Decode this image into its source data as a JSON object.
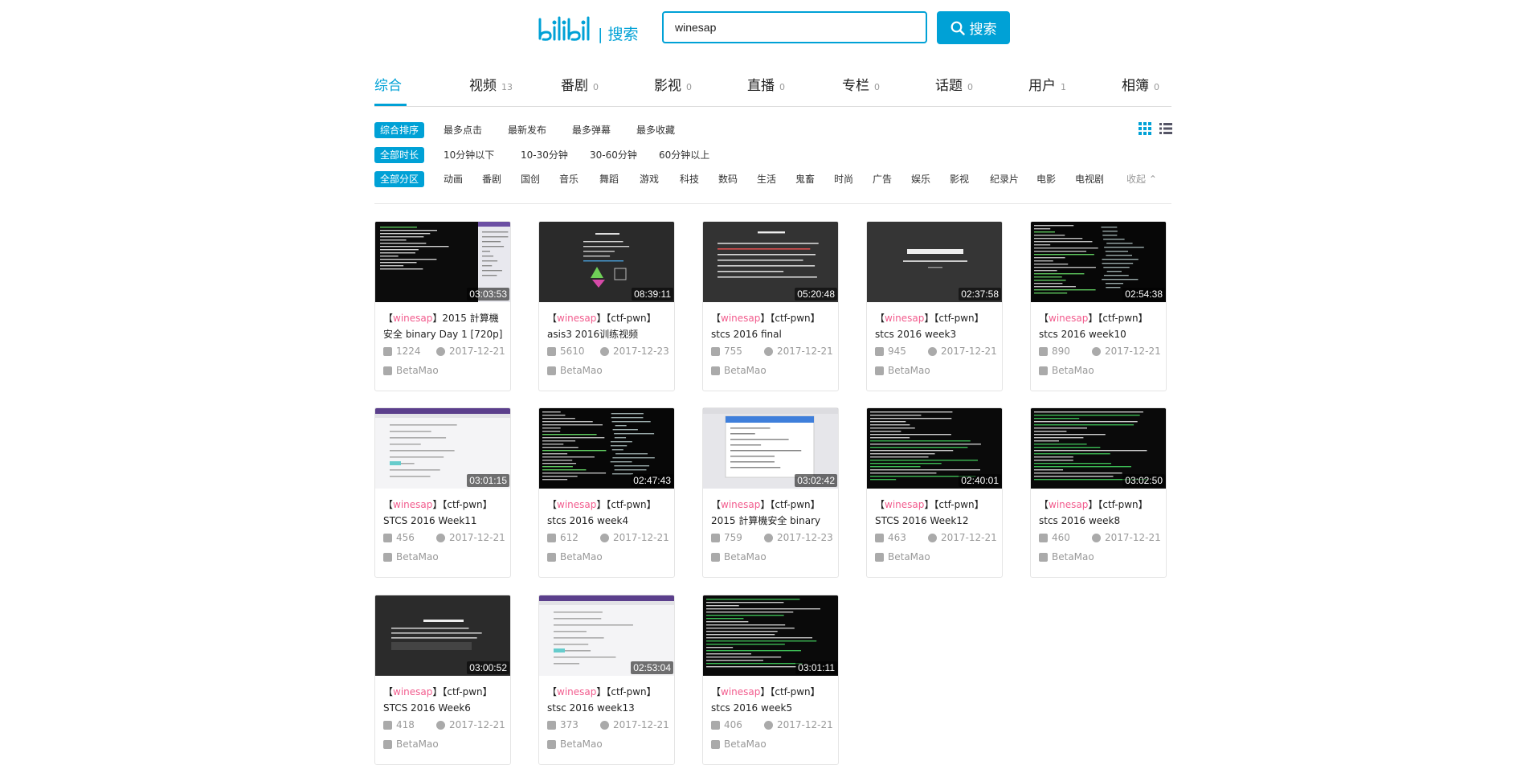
{
  "header": {
    "logo_text": "bilibili",
    "logo_suffix": "| 搜索",
    "search_value": "winesap",
    "search_button": "搜索"
  },
  "tabs": [
    {
      "label": "综合",
      "count": ""
    },
    {
      "label": "视频",
      "count": "13"
    },
    {
      "label": "番剧",
      "count": "0"
    },
    {
      "label": "影视",
      "count": "0"
    },
    {
      "label": "直播",
      "count": "0"
    },
    {
      "label": "专栏",
      "count": "0"
    },
    {
      "label": "话题",
      "count": "0"
    },
    {
      "label": "用户",
      "count": "1"
    },
    {
      "label": "相簿",
      "count": "0"
    }
  ],
  "filters": {
    "sort": [
      "综合排序",
      "最多点击",
      "最新发布",
      "最多弹幕",
      "最多收藏"
    ],
    "duration": [
      "全部时长",
      "10分钟以下",
      "10-30分钟",
      "30-60分钟",
      "60分钟以上"
    ],
    "zone": [
      "全部分区",
      "动画",
      "番剧",
      "国创",
      "音乐",
      "舞蹈",
      "游戏",
      "科技",
      "数码",
      "生活",
      "鬼畜",
      "时尚",
      "广告",
      "娱乐",
      "影视",
      "纪录片",
      "电影",
      "电视剧"
    ],
    "collapse": "收起"
  },
  "keyword": "winesap",
  "videos": [
    {
      "line1_prefix": "【",
      "kw": "winesap",
      "line1_suffix": "】2015 計算機",
      "line2": "安全 binary Day 1 [720p]",
      "duration": "03:03:53",
      "plays": "1224",
      "date": "2017-12-21",
      "author": "BetaMao",
      "thumb": "terminal-split"
    },
    {
      "line1_prefix": "【",
      "kw": "winesap",
      "line1_suffix": "】【ctf-pwn】",
      "line2": "asis3 2016训练视频",
      "duration": "08:39:11",
      "plays": "5610",
      "date": "2017-12-23",
      "author": "BetaMao",
      "thumb": "slide-about"
    },
    {
      "line1_prefix": "【",
      "kw": "winesap",
      "line1_suffix": "】【ctf-pwn】",
      "line2": "stcs 2016 final",
      "duration": "05:20:48",
      "plays": "755",
      "date": "2017-12-21",
      "author": "BetaMao",
      "thumb": "slide-seccomp"
    },
    {
      "line1_prefix": "【",
      "kw": "winesap",
      "line1_suffix": "】【ctf-pwn】",
      "line2": "stcs 2016 week3",
      "duration": "02:37:58",
      "plays": "945",
      "date": "2017-12-21",
      "author": "BetaMao",
      "thumb": "slide-pwnable"
    },
    {
      "line1_prefix": "【",
      "kw": "winesap",
      "line1_suffix": "】【ctf-pwn】",
      "line2": "stcs 2016 week10",
      "duration": "02:54:38",
      "plays": "890",
      "date": "2017-12-21",
      "author": "BetaMao",
      "thumb": "terminal-dark"
    },
    {
      "line1_prefix": "【",
      "kw": "winesap",
      "line1_suffix": "】【ctf-pwn】",
      "line2": "STCS 2016 Week11",
      "duration": "03:01:15",
      "plays": "456",
      "date": "2017-12-21",
      "author": "BetaMao",
      "thumb": "browser-light"
    },
    {
      "line1_prefix": "【",
      "kw": "winesap",
      "line1_suffix": "】【ctf-pwn】",
      "line2": "stcs 2016 week4",
      "duration": "02:47:43",
      "plays": "612",
      "date": "2017-12-21",
      "author": "BetaMao",
      "thumb": "terminal-dark"
    },
    {
      "line1_prefix": "【",
      "kw": "winesap",
      "line1_suffix": "】【ctf-pwn】",
      "line2": "2015 計算機安全 binary",
      "duration": "03:02:42",
      "plays": "759",
      "date": "2017-12-23",
      "author": "BetaMao",
      "thumb": "browser-dialog"
    },
    {
      "line1_prefix": "【",
      "kw": "winesap",
      "line1_suffix": "】【ctf-pwn】",
      "line2": "STCS 2016 Week12",
      "duration": "02:40:01",
      "plays": "463",
      "date": "2017-12-21",
      "author": "BetaMao",
      "thumb": "terminal-green"
    },
    {
      "line1_prefix": "【",
      "kw": "winesap",
      "line1_suffix": "】【ctf-pwn】",
      "line2": "stcs 2016 week8",
      "duration": "03:02:50",
      "plays": "460",
      "date": "2017-12-21",
      "author": "BetaMao",
      "thumb": "terminal-green"
    },
    {
      "line1_prefix": "【",
      "kw": "winesap",
      "line1_suffix": "】【ctf-pwn】",
      "line2": "STCS 2016 Week6",
      "duration": "03:00:52",
      "plays": "418",
      "date": "2017-12-21",
      "author": "BetaMao",
      "thumb": "slide-format"
    },
    {
      "line1_prefix": "【",
      "kw": "winesap",
      "line1_suffix": "】【ctf-pwn】",
      "line2": "stsc 2016 week13",
      "duration": "02:53:04",
      "plays": "373",
      "date": "2017-12-21",
      "author": "BetaMao",
      "thumb": "browser-form"
    },
    {
      "line1_prefix": "【",
      "kw": "winesap",
      "line1_suffix": "】【ctf-pwn】",
      "line2": "stcs 2016 week5",
      "duration": "03:01:11",
      "plays": "406",
      "date": "2017-12-21",
      "author": "BetaMao",
      "thumb": "terminal-green"
    }
  ],
  "colors": {
    "accent": "#00a1d6",
    "keyword": "#f25d8e",
    "muted": "#999999"
  }
}
